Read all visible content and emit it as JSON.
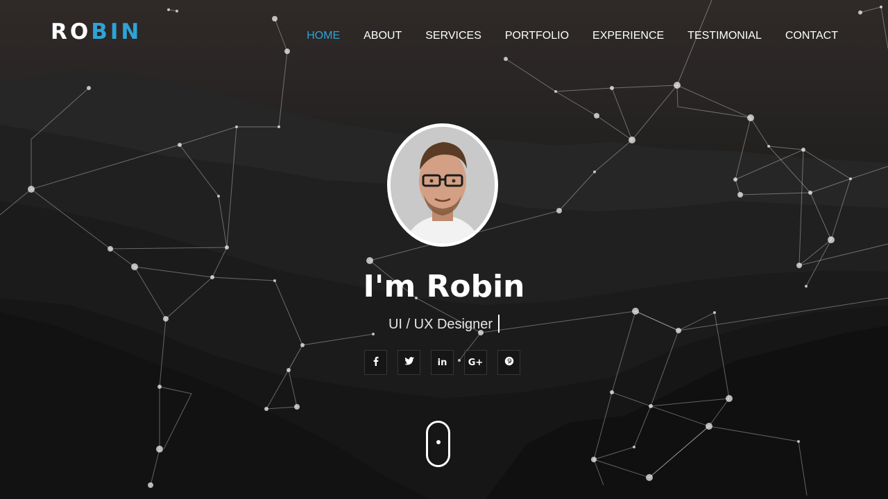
{
  "brand": {
    "part1": "RO",
    "part2": "BIN",
    "accent": "#2fa3d6"
  },
  "nav": {
    "items": [
      {
        "label": "HOME",
        "active": true
      },
      {
        "label": "ABOUT"
      },
      {
        "label": "SERVICES"
      },
      {
        "label": "PORTFOLIO"
      },
      {
        "label": "EXPERIENCE"
      },
      {
        "label": "TESTIMONIAL"
      },
      {
        "label": "CONTACT"
      }
    ]
  },
  "hero": {
    "title": "I'm Robin",
    "subtitle": "UI / UX Designer",
    "social": [
      {
        "icon": "facebook-icon",
        "glyph": "f"
      },
      {
        "icon": "twitter-icon",
        "glyph": "🐦"
      },
      {
        "icon": "linkedin-icon",
        "glyph": "in"
      },
      {
        "icon": "google-plus-icon",
        "glyph": "G+"
      },
      {
        "icon": "pinterest-icon",
        "glyph": "P"
      }
    ]
  },
  "colors": {
    "accent": "#2fa3d6",
    "text": "#ffffff",
    "background": "#1e1d1d"
  }
}
